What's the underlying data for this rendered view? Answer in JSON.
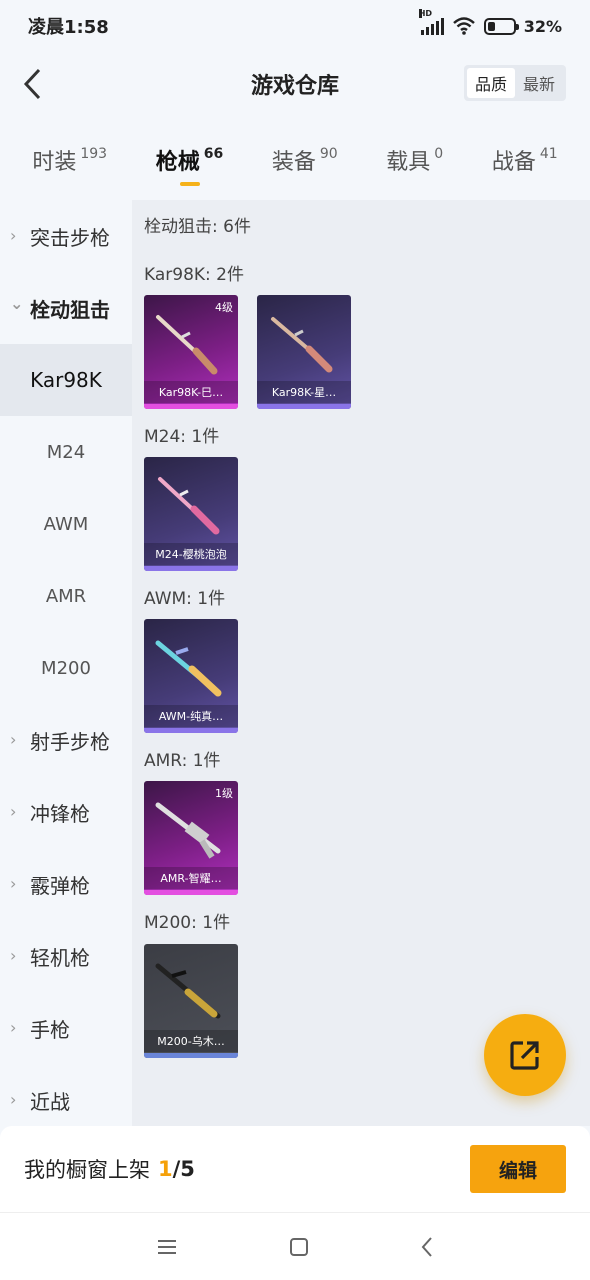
{
  "status": {
    "time": "凌晨1:58",
    "battery": "32%",
    "battery_level": 0.32,
    "net_badge": "HD"
  },
  "header": {
    "title": "游戏仓库",
    "sort_options": [
      "品质",
      "最新"
    ],
    "sort_selected": "品质"
  },
  "tabs": [
    {
      "label": "时装",
      "count": "193"
    },
    {
      "label": "枪械",
      "count": "66",
      "active": true
    },
    {
      "label": "装备",
      "count": "90"
    },
    {
      "label": "载具",
      "count": "0"
    },
    {
      "label": "战备",
      "count": "41"
    }
  ],
  "sidebar": {
    "groups": [
      {
        "label": "突击步枪"
      },
      {
        "label": "栓动狙击",
        "expanded": true
      },
      {
        "label": "射手步枪"
      },
      {
        "label": "冲锋枪"
      },
      {
        "label": "霰弹枪"
      },
      {
        "label": "轻机枪"
      },
      {
        "label": "手枪"
      },
      {
        "label": "近战"
      }
    ],
    "subs": [
      {
        "label": "Kar98K",
        "selected": true
      },
      {
        "label": "M24"
      },
      {
        "label": "AWM"
      },
      {
        "label": "AMR"
      },
      {
        "label": "M200"
      }
    ]
  },
  "content": {
    "summary": "栓动狙击: 6件",
    "sections": [
      {
        "title": "Kar98K: 2件",
        "items": [
          {
            "name": "Kar98K-巳…",
            "level": "4级",
            "rarity": "pink"
          },
          {
            "name": "Kar98K-星…",
            "level": "",
            "rarity": "purple"
          }
        ]
      },
      {
        "title": "M24: 1件",
        "items": [
          {
            "name": "M24-樱桃泡泡",
            "level": "",
            "rarity": "purple"
          }
        ]
      },
      {
        "title": "AWM: 1件",
        "items": [
          {
            "name": "AWM-纯真…",
            "level": "",
            "rarity": "purple"
          }
        ]
      },
      {
        "title": "AMR: 1件",
        "items": [
          {
            "name": "AMR-智耀…",
            "level": "1级",
            "rarity": "pink"
          }
        ]
      },
      {
        "title": "M200: 1件",
        "items": [
          {
            "name": "M200-乌木…",
            "level": "",
            "rarity": "gray"
          }
        ]
      }
    ]
  },
  "showcase": {
    "label": "我的橱窗上架",
    "current": "1",
    "max": "/5",
    "edit_label": "编辑"
  },
  "colors": {
    "accent": "#f6a30e",
    "pink": "#b230c0",
    "purple": "#463c78",
    "gray": "#4d5058"
  }
}
